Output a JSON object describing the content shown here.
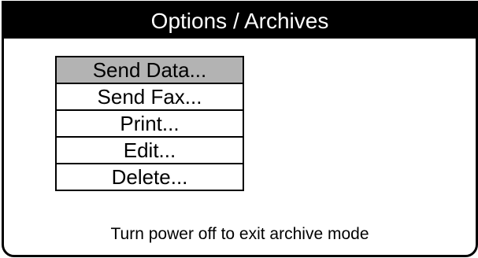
{
  "window": {
    "title": "Options / Archives"
  },
  "menu": {
    "items": [
      {
        "label": "Send Data...",
        "selected": true
      },
      {
        "label": "Send Fax...",
        "selected": false
      },
      {
        "label": "Print...",
        "selected": false
      },
      {
        "label": "Edit...",
        "selected": false
      },
      {
        "label": "Delete...",
        "selected": false
      }
    ]
  },
  "status": {
    "message": "Turn power off to exit archive mode"
  },
  "colors": {
    "title_bar_bg": "#000000",
    "title_text": "#ffffff",
    "selected_item_bg": "#b3b3b3",
    "border": "#000000"
  }
}
